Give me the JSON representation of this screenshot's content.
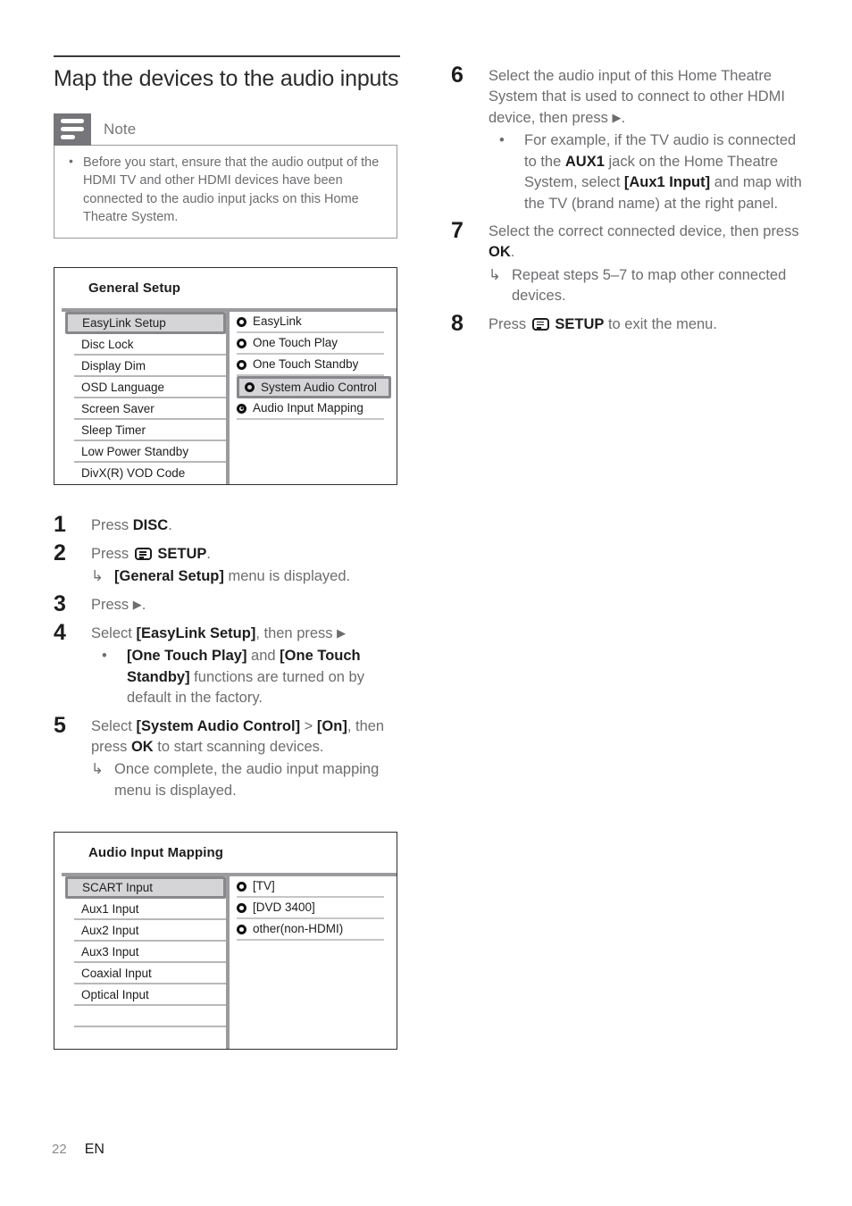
{
  "page": {
    "number": "22",
    "language": "EN"
  },
  "section": {
    "title": "Map the devices to the audio inputs"
  },
  "note": {
    "label": "Note",
    "icon": "note-lines-icon",
    "items": [
      "Before you start, ensure that the audio output of the HDMI TV and other HDMI devices have been connected to the audio input jacks on this Home Theatre System."
    ]
  },
  "general_setup_menu": {
    "title": "General Setup",
    "left_items": [
      {
        "label": "EasyLink Setup",
        "selected": true
      },
      {
        "label": "Disc Lock",
        "selected": false
      },
      {
        "label": "Display Dim",
        "selected": false
      },
      {
        "label": "OSD Language",
        "selected": false
      },
      {
        "label": "Screen Saver",
        "selected": false
      },
      {
        "label": "Sleep Timer",
        "selected": false
      },
      {
        "label": "Low Power Standby",
        "selected": false
      },
      {
        "label": "DivX(R) VOD Code",
        "selected": false
      }
    ],
    "right_items": [
      {
        "label": "EasyLink",
        "selected": false,
        "filled": false
      },
      {
        "label": "One Touch Play",
        "selected": false,
        "filled": false
      },
      {
        "label": "One Touch Standby",
        "selected": false,
        "filled": false
      },
      {
        "label": "System Audio Control",
        "selected": true,
        "filled": false
      },
      {
        "label": "Audio Input Mapping",
        "selected": false,
        "filled": true
      },
      {
        "label": "",
        "selected": false,
        "filled": false
      },
      {
        "label": "",
        "selected": false,
        "filled": false
      },
      {
        "label": "",
        "selected": false,
        "filled": false
      }
    ]
  },
  "audio_input_mapping_menu": {
    "title": "Audio Input Mapping",
    "left_items": [
      {
        "label": "SCART Input",
        "selected": true
      },
      {
        "label": "Aux1 Input",
        "selected": false
      },
      {
        "label": "Aux2 Input",
        "selected": false
      },
      {
        "label": "Aux3 Input",
        "selected": false
      },
      {
        "label": "Coaxial Input",
        "selected": false
      },
      {
        "label": "Optical Input",
        "selected": false
      },
      {
        "label": "",
        "selected": false
      },
      {
        "label": "",
        "selected": false
      }
    ],
    "right_items": [
      {
        "label": "[TV]",
        "filled": false
      },
      {
        "label": "[DVD 3400]",
        "filled": false
      },
      {
        "label": "other(non-HDMI)",
        "filled": false
      },
      {
        "label": "",
        "filled": false
      },
      {
        "label": "",
        "filled": false
      },
      {
        "label": "",
        "filled": false
      },
      {
        "label": "",
        "filled": false
      },
      {
        "label": "",
        "filled": false
      }
    ]
  },
  "steps_left": [
    {
      "num": "1",
      "html": "Press <b>DISC</b>."
    },
    {
      "num": "2",
      "html": "Press <span class=\"setup-glyph\"><i></i><i></i><i></i></span> <b>SETUP</b>.",
      "subs": [
        {
          "mark": "↳",
          "type": "arrow",
          "html": "<b>[General Setup]</b> menu is displayed."
        }
      ]
    },
    {
      "num": "3",
      "html": "Press <span class=\"tri\">▶</span>."
    },
    {
      "num": "4",
      "html": "Select <b>[EasyLink Setup]</b>, then press <span class=\"tri\">▶</span>",
      "subs": [
        {
          "mark": "•",
          "type": "dot",
          "html": "<b>[One Touch Play]</b> and <b>[One Touch Standby]</b> functions are turned on by default in the factory."
        }
      ]
    },
    {
      "num": "5",
      "html": "Select <b>[System Audio Control]</b> &gt; <b>[On]</b>, then press <b>OK</b> to start scanning devices.",
      "subs": [
        {
          "mark": "↳",
          "type": "arrow",
          "html": "Once complete, the audio input mapping menu is displayed."
        }
      ]
    }
  ],
  "steps_right": [
    {
      "num": "6",
      "html": "Select the audio input of this Home Theatre System that is used to connect to other HDMI device, then press <span class=\"tri\">▶</span>.",
      "subs": [
        {
          "mark": "•",
          "type": "dot",
          "html": "For example, if the TV audio is connected to the <b>AUX1</b> jack on the Home Theatre System, select <b>[Aux1 Input]</b> and map with the TV (brand name) at the right panel."
        }
      ]
    },
    {
      "num": "7",
      "html": "Select the correct connected device, then press <b>OK</b>.",
      "subs": [
        {
          "mark": "↳",
          "type": "arrow",
          "html": "Repeat steps 5–7 to map other connected devices."
        }
      ]
    },
    {
      "num": "8",
      "html": "Press <span class=\"setup-glyph\"><i></i><i></i><i></i></span> <b>SETUP</b> to exit the menu."
    }
  ],
  "colors": {
    "body_text": "#6d6d70",
    "emphasis_text": "#1d1d1f",
    "note_icon_bg": "#76767a",
    "menu_border": "#2f2f31",
    "menu_selected_bg": "#d5d5d7",
    "menu_selected_border": "#88888c",
    "menu_divider": "#9b9b9e"
  }
}
